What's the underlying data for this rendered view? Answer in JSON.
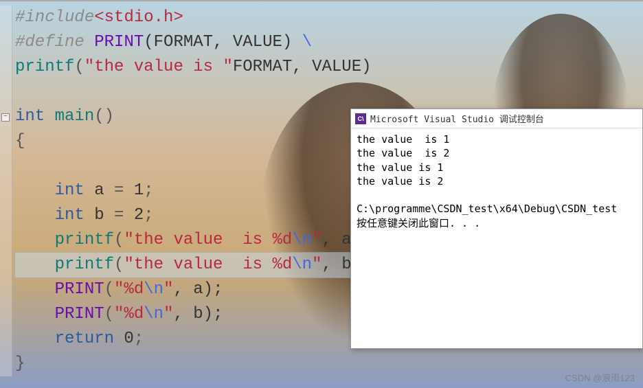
{
  "code": {
    "line1_hash": "#",
    "line1_include": "include",
    "line1_angle_open": "<",
    "line1_header": "stdio.h",
    "line1_angle_close": ">",
    "line2_hash": "#",
    "line2_define": "define",
    "line2_macro": " PRINT",
    "line2_params": "(FORMAT, VALUE) ",
    "line2_backslash": "\\",
    "line3_printf": "printf",
    "line3_paren_open": "(",
    "line3_str": "\"the value is \"",
    "line3_rest": "FORMAT, VALUE)",
    "line5_int": "int",
    "line5_main": " main",
    "line5_parens": "()",
    "line6_brace": "{",
    "line8_int": "int",
    "line8_var": " a ",
    "line8_eq": "=",
    "line8_val": " 1",
    "line8_semi": ";",
    "line9_int": "int",
    "line9_var": " b ",
    "line9_eq": "=",
    "line9_val": " 2",
    "line9_semi": ";",
    "line10_printf": "printf",
    "line10_po": "(",
    "line10_str1": "\"the value  is %d",
    "line10_esc": "\\n",
    "line10_str2": "\"",
    "line10_rest": ", a);",
    "line11_printf": "printf",
    "line11_po": "(",
    "line11_str1": "\"the value  is %d",
    "line11_esc": "\\n",
    "line11_str2": "\"",
    "line11_rest": ", b);",
    "line12_macro": "PRINT",
    "line12_po": "(",
    "line12_str1": "\"%d",
    "line12_esc": "\\n",
    "line12_str2": "\"",
    "line12_rest": ", a);",
    "line13_macro": "PRINT",
    "line13_po": "(",
    "line13_str1": "\"%d",
    "line13_esc": "\\n",
    "line13_str2": "\"",
    "line13_rest": ", b);",
    "line14_return": "return",
    "line14_val": " 0",
    "line14_semi": ";",
    "line15_brace": "}"
  },
  "console": {
    "icon_text": "C\\",
    "title": "Microsoft Visual Studio 调试控制台",
    "output": "the value  is 1\nthe value  is 2\nthe value is 1\nthe value is 2\n\nC:\\programme\\CSDN_test\\x64\\Debug\\CSDN_test\n按任意键关闭此窗口. . ."
  },
  "watermark": "CSDN @浪雨123",
  "fold_marker": "−"
}
